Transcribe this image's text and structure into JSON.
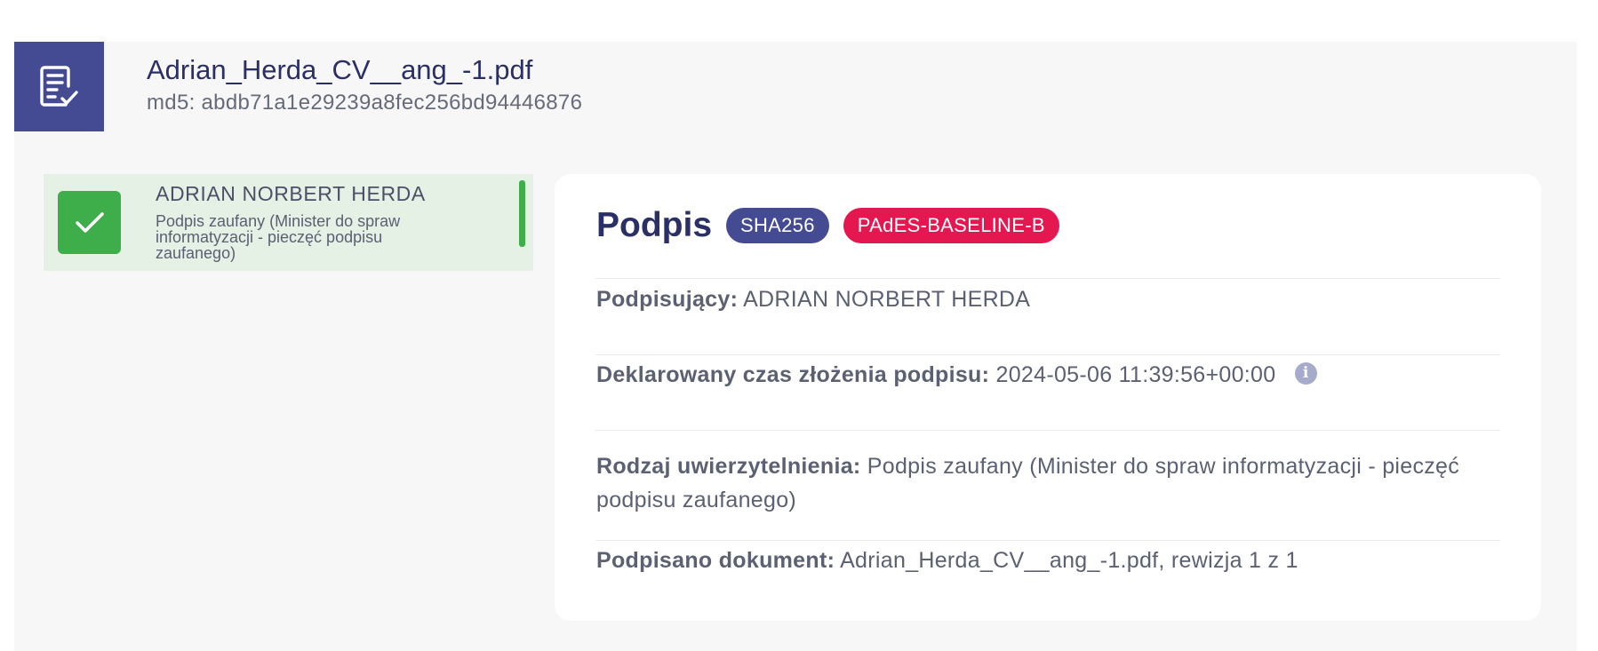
{
  "file": {
    "name": "Adrian_Herda_CV__ang_-1.pdf",
    "hash": "md5: abdb71a1e29239a8fec256bd94446876",
    "icon": "document-check-icon"
  },
  "signer_card": {
    "name": "ADRIAN NORBERT HERDA",
    "description": "Podpis zaufany (Minister do spraw informatyzacji - pieczęć podpisu zaufanego)",
    "status_icon": "checkmark-icon",
    "status_color": "#3eae4a"
  },
  "details": {
    "title": "Podpis",
    "badges": {
      "hash_algorithm": "SHA256",
      "format": "PAdES-BASELINE-B"
    },
    "rows": {
      "signer_label": "Podpisujący:",
      "signer_value": "ADRIAN NORBERT HERDA",
      "time_label": "Deklarowany czas złożenia podpisu:",
      "time_value": "2024-05-06 11:39:56+00:00",
      "auth_label": "Rodzaj uwierzytelnienia:",
      "auth_value": "Podpis zaufany (Minister do spraw informatyzacji - pieczęć podpisu zaufanego)",
      "document_label": "Podpisano dokument:",
      "document_value": "Adrian_Herda_CV__ang_-1.pdf, rewizja 1 z 1"
    },
    "info_icon": "info-icon"
  },
  "colors": {
    "primary": "#454b93",
    "accent": "#e41750",
    "success": "#3eae4a",
    "title_text": "#2a2f66"
  }
}
